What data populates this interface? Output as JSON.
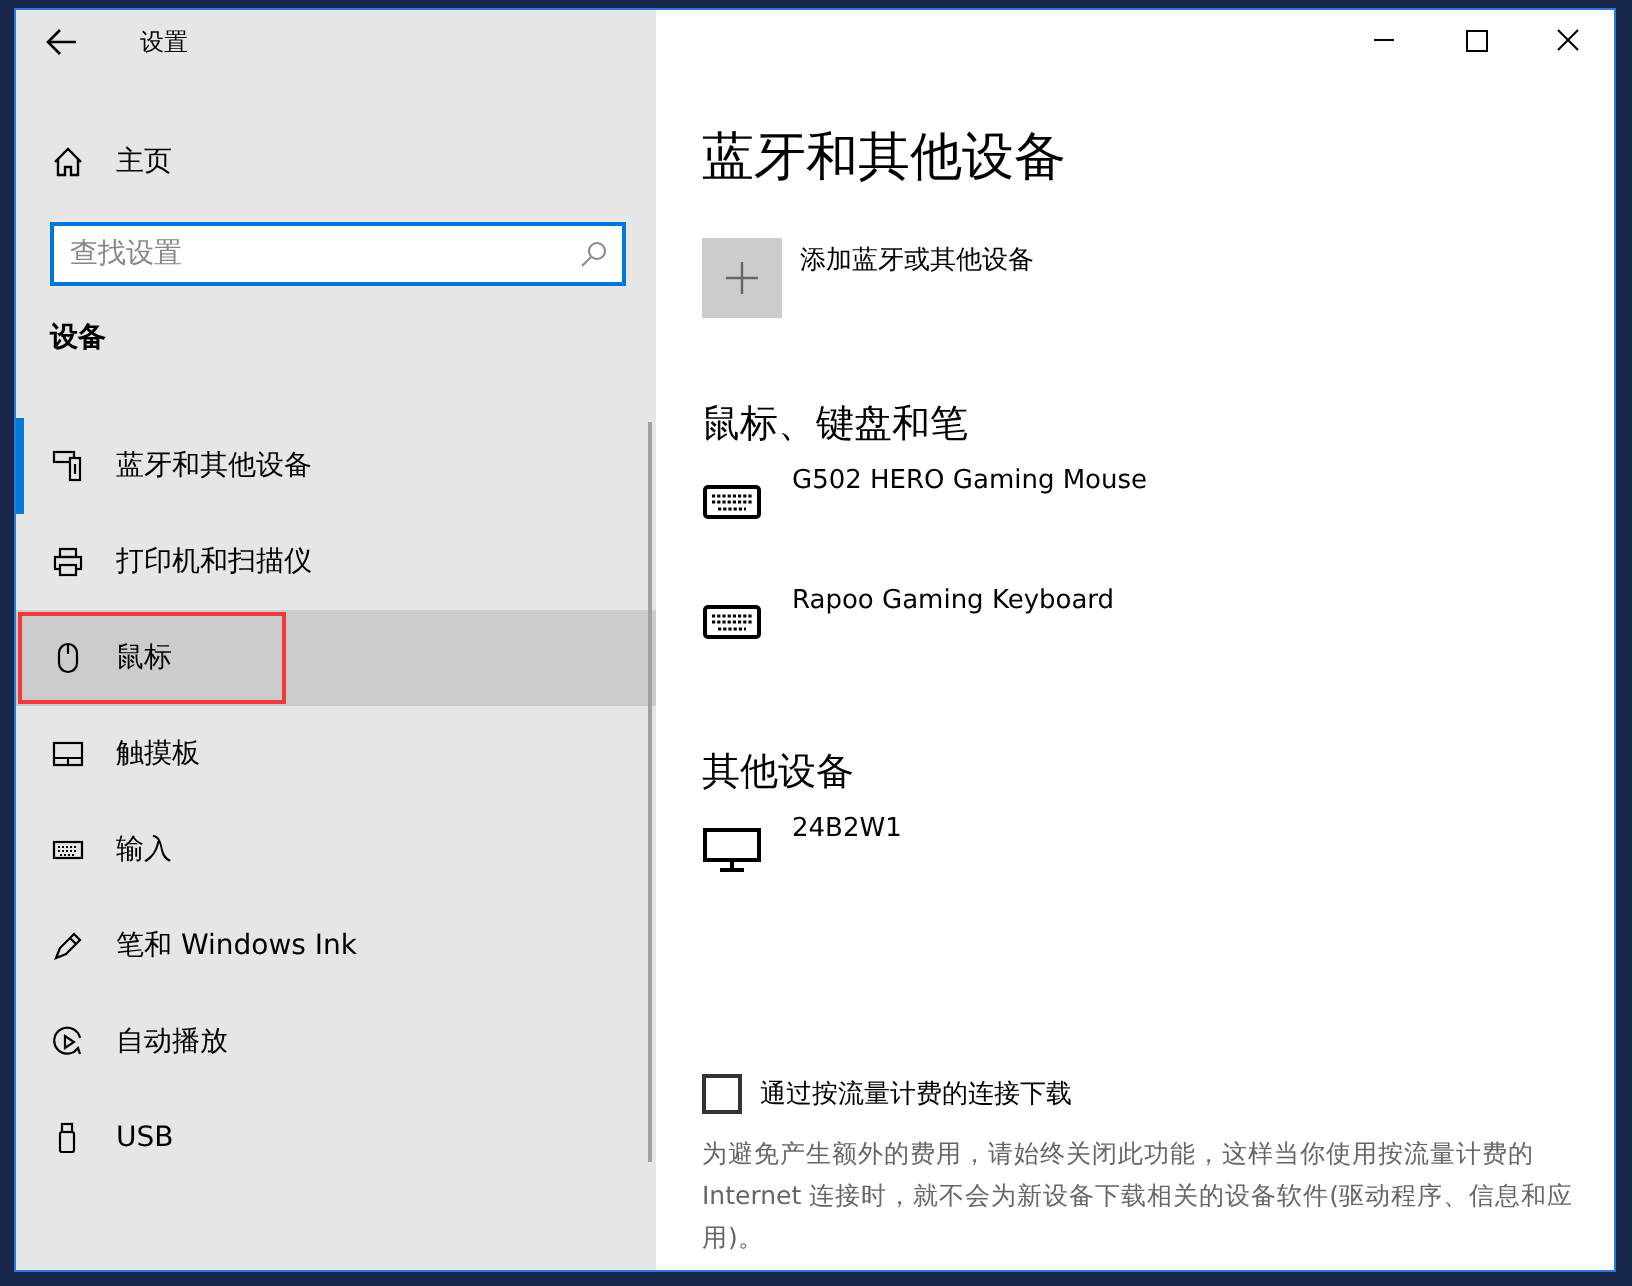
{
  "window": {
    "title": "设置"
  },
  "sidebar": {
    "home": "主页",
    "search": {
      "placeholder": "查找设置"
    },
    "section": "设备",
    "items": [
      {
        "label": "蓝牙和其他设备",
        "selected": true,
        "highlighted": false,
        "annotated": false
      },
      {
        "label": "打印机和扫描仪",
        "selected": false,
        "highlighted": false,
        "annotated": false
      },
      {
        "label": "鼠标",
        "selected": false,
        "highlighted": true,
        "annotated": true
      },
      {
        "label": "触摸板",
        "selected": false,
        "highlighted": false,
        "annotated": false
      },
      {
        "label": "输入",
        "selected": false,
        "highlighted": false,
        "annotated": false
      },
      {
        "label": "笔和 Windows Ink",
        "selected": false,
        "highlighted": false,
        "annotated": false
      },
      {
        "label": "自动播放",
        "selected": false,
        "highlighted": false,
        "annotated": false
      },
      {
        "label": "USB",
        "selected": false,
        "highlighted": false,
        "annotated": false
      }
    ]
  },
  "page": {
    "title": "蓝牙和其他设备",
    "add_button": {
      "label": "添加蓝牙或其他设备"
    },
    "sections": [
      {
        "heading": "鼠标、键盘和笔",
        "devices": [
          {
            "name": "G502 HERO Gaming Mouse",
            "kind": "keyboard"
          },
          {
            "name": "Rapoo Gaming Keyboard",
            "kind": "keyboard"
          }
        ]
      },
      {
        "heading": "其他设备",
        "devices": [
          {
            "name": "24B2W1",
            "kind": "monitor"
          }
        ]
      }
    ],
    "metered": {
      "label": "通过按流量计费的连接下载",
      "checked": false,
      "description": "为避免产生额外的费用，请始终关闭此功能，这样当你使用按流量计费的 Internet 连接时，就不会为新设备下载相关的设备软件(驱动程序、信息和应用)。"
    }
  }
}
